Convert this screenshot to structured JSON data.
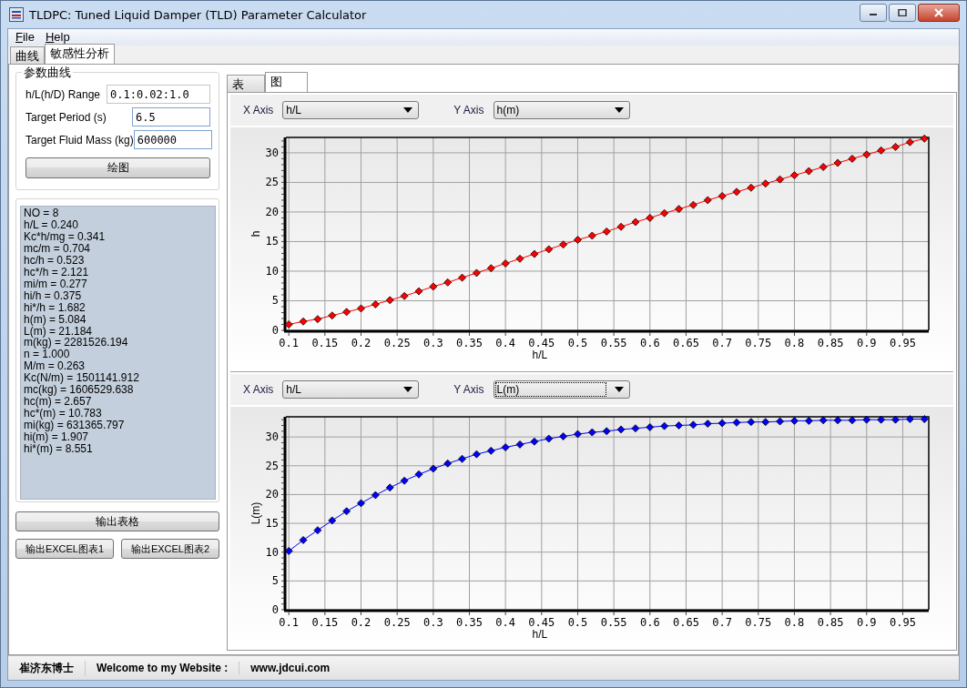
{
  "window": {
    "title": "TLDPC: Tuned Liquid Damper (TLD) Parameter Calculator"
  },
  "menu": [
    {
      "label": "File"
    },
    {
      "label": "Help"
    }
  ],
  "tabs": [
    {
      "label": "曲线",
      "selected": false
    },
    {
      "label": "敏感性分析",
      "selected": true
    }
  ],
  "parameters": {
    "title": "参数曲线",
    "fields": [
      {
        "label": "h/L(h/D) Range",
        "value": "0.1:0.02:1.0",
        "highlighted": false
      },
      {
        "label": "Target Period (s)",
        "value": "6.5",
        "highlighted": true
      },
      {
        "label": "Target Fluid Mass (kg)",
        "value": "600000",
        "highlighted": true
      }
    ],
    "plot_button": "绘图"
  },
  "results": [
    "NO = 8",
    "h/L = 0.240",
    "Kc*h/mg = 0.341",
    "mc/m = 0.704",
    "hc/h = 0.523",
    "hc*/h = 2.121",
    "mi/m = 0.277",
    "hi/h = 0.375",
    "hi*/h = 1.682",
    "h(m) = 5.084",
    "L(m) = 21.184",
    "m(kg) = 2281526.194",
    "n = 1.000",
    "M/m = 0.263",
    "Kc(N/m) = 1501141.912",
    "mc(kg) = 1606529.638",
    "hc(m) = 2.657",
    "hc*(m) = 10.783",
    "mi(kg) = 631365.797",
    "hi(m) = 1.907",
    "hi*(m) = 8.551"
  ],
  "export_table_button": "输出表格",
  "export_chart_buttons": [
    "输出EXCEL图表1",
    "输出EXCEL图表2"
  ],
  "view_tabs": [
    {
      "label": "表",
      "selected": false
    },
    {
      "label": "图",
      "selected": true
    }
  ],
  "plots": [
    {
      "x_axis": {
        "label": "X Axis",
        "value": "h/L",
        "focused": false
      },
      "y_axis": {
        "label": "Y Axis",
        "value": "h(m)",
        "focused": false
      },
      "chart_data": {
        "type": "line",
        "xlabel": "h/L",
        "ylabel": "h",
        "grid": true,
        "x": [
          0.1,
          0.12,
          0.14,
          0.16,
          0.18,
          0.2,
          0.22,
          0.24,
          0.26,
          0.28,
          0.3,
          0.32,
          0.34,
          0.36,
          0.38,
          0.4,
          0.42,
          0.44,
          0.46,
          0.48,
          0.5,
          0.52,
          0.54,
          0.56,
          0.58,
          0.6,
          0.62,
          0.64,
          0.66,
          0.68,
          0.7,
          0.72,
          0.74,
          0.76,
          0.78,
          0.8,
          0.82,
          0.84,
          0.86,
          0.88,
          0.9,
          0.92,
          0.94,
          0.96,
          0.98
        ],
        "series": [
          {
            "color": "#ff0000",
            "marker": "diamond",
            "values": [
              1.0,
              1.5,
              1.9,
              2.5,
              3.1,
              3.7,
              4.4,
              5.1,
              5.8,
              6.6,
              7.4,
              8.1,
              8.9,
              9.7,
              10.5,
              11.3,
              12.1,
              12.9,
              13.7,
              14.5,
              15.3,
              16.0,
              16.7,
              17.5,
              18.3,
              19.0,
              19.8,
              20.5,
              21.2,
              22.0,
              22.7,
              23.4,
              24.1,
              24.8,
              25.5,
              26.2,
              26.9,
              27.6,
              28.3,
              29.0,
              29.7,
              30.4,
              31.0,
              31.8,
              32.4
            ]
          }
        ],
        "xlim": [
          0.096,
          0.986
        ],
        "ylim": [
          0,
          32.6
        ],
        "xticks": [
          0.1,
          0.15,
          0.2,
          0.25,
          0.3,
          0.35,
          0.4,
          0.45,
          0.5,
          0.55,
          0.6,
          0.65,
          0.7,
          0.75,
          0.8,
          0.85,
          0.9,
          0.95
        ],
        "yticks": [
          0,
          5,
          10,
          15,
          20,
          25,
          30
        ]
      }
    },
    {
      "x_axis": {
        "label": "X Axis",
        "value": "h/L",
        "focused": false
      },
      "y_axis": {
        "label": "Y Axis",
        "value": "L(m)",
        "focused": true
      },
      "chart_data": {
        "type": "line",
        "xlabel": "h/L",
        "ylabel": "L(m)",
        "grid": true,
        "x": [
          0.1,
          0.12,
          0.14,
          0.16,
          0.18,
          0.2,
          0.22,
          0.24,
          0.26,
          0.28,
          0.3,
          0.32,
          0.34,
          0.36,
          0.38,
          0.4,
          0.42,
          0.44,
          0.46,
          0.48,
          0.5,
          0.52,
          0.54,
          0.56,
          0.58,
          0.6,
          0.62,
          0.64,
          0.66,
          0.68,
          0.7,
          0.72,
          0.74,
          0.76,
          0.78,
          0.8,
          0.82,
          0.84,
          0.86,
          0.88,
          0.9,
          0.92,
          0.94,
          0.96,
          0.98
        ],
        "series": [
          {
            "color": "#0000ff",
            "marker": "diamond",
            "values": [
              10.2,
              12.1,
              13.8,
              15.5,
              17.1,
              18.5,
              19.9,
              21.2,
              22.4,
              23.5,
              24.5,
              25.4,
              26.2,
              27.0,
              27.6,
              28.2,
              28.7,
              29.2,
              29.7,
              30.1,
              30.5,
              30.8,
              31.0,
              31.3,
              31.5,
              31.7,
              31.9,
              32.0,
              32.1,
              32.3,
              32.4,
              32.5,
              32.6,
              32.6,
              32.7,
              32.8,
              32.8,
              32.9,
              32.9,
              32.9,
              33.0,
              33.0,
              33.0,
              33.1,
              33.1
            ]
          }
        ],
        "xlim": [
          0.096,
          0.986
        ],
        "ylim": [
          0,
          33.5
        ],
        "xticks": [
          0.1,
          0.15,
          0.2,
          0.25,
          0.3,
          0.35,
          0.4,
          0.45,
          0.5,
          0.55,
          0.6,
          0.65,
          0.7,
          0.75,
          0.8,
          0.85,
          0.9,
          0.95
        ],
        "yticks": [
          0,
          5,
          10,
          15,
          20,
          25,
          30
        ]
      }
    }
  ],
  "status_bar": [
    "崔济东博士",
    "Welcome to my Website :",
    "www.jdcui.com"
  ]
}
